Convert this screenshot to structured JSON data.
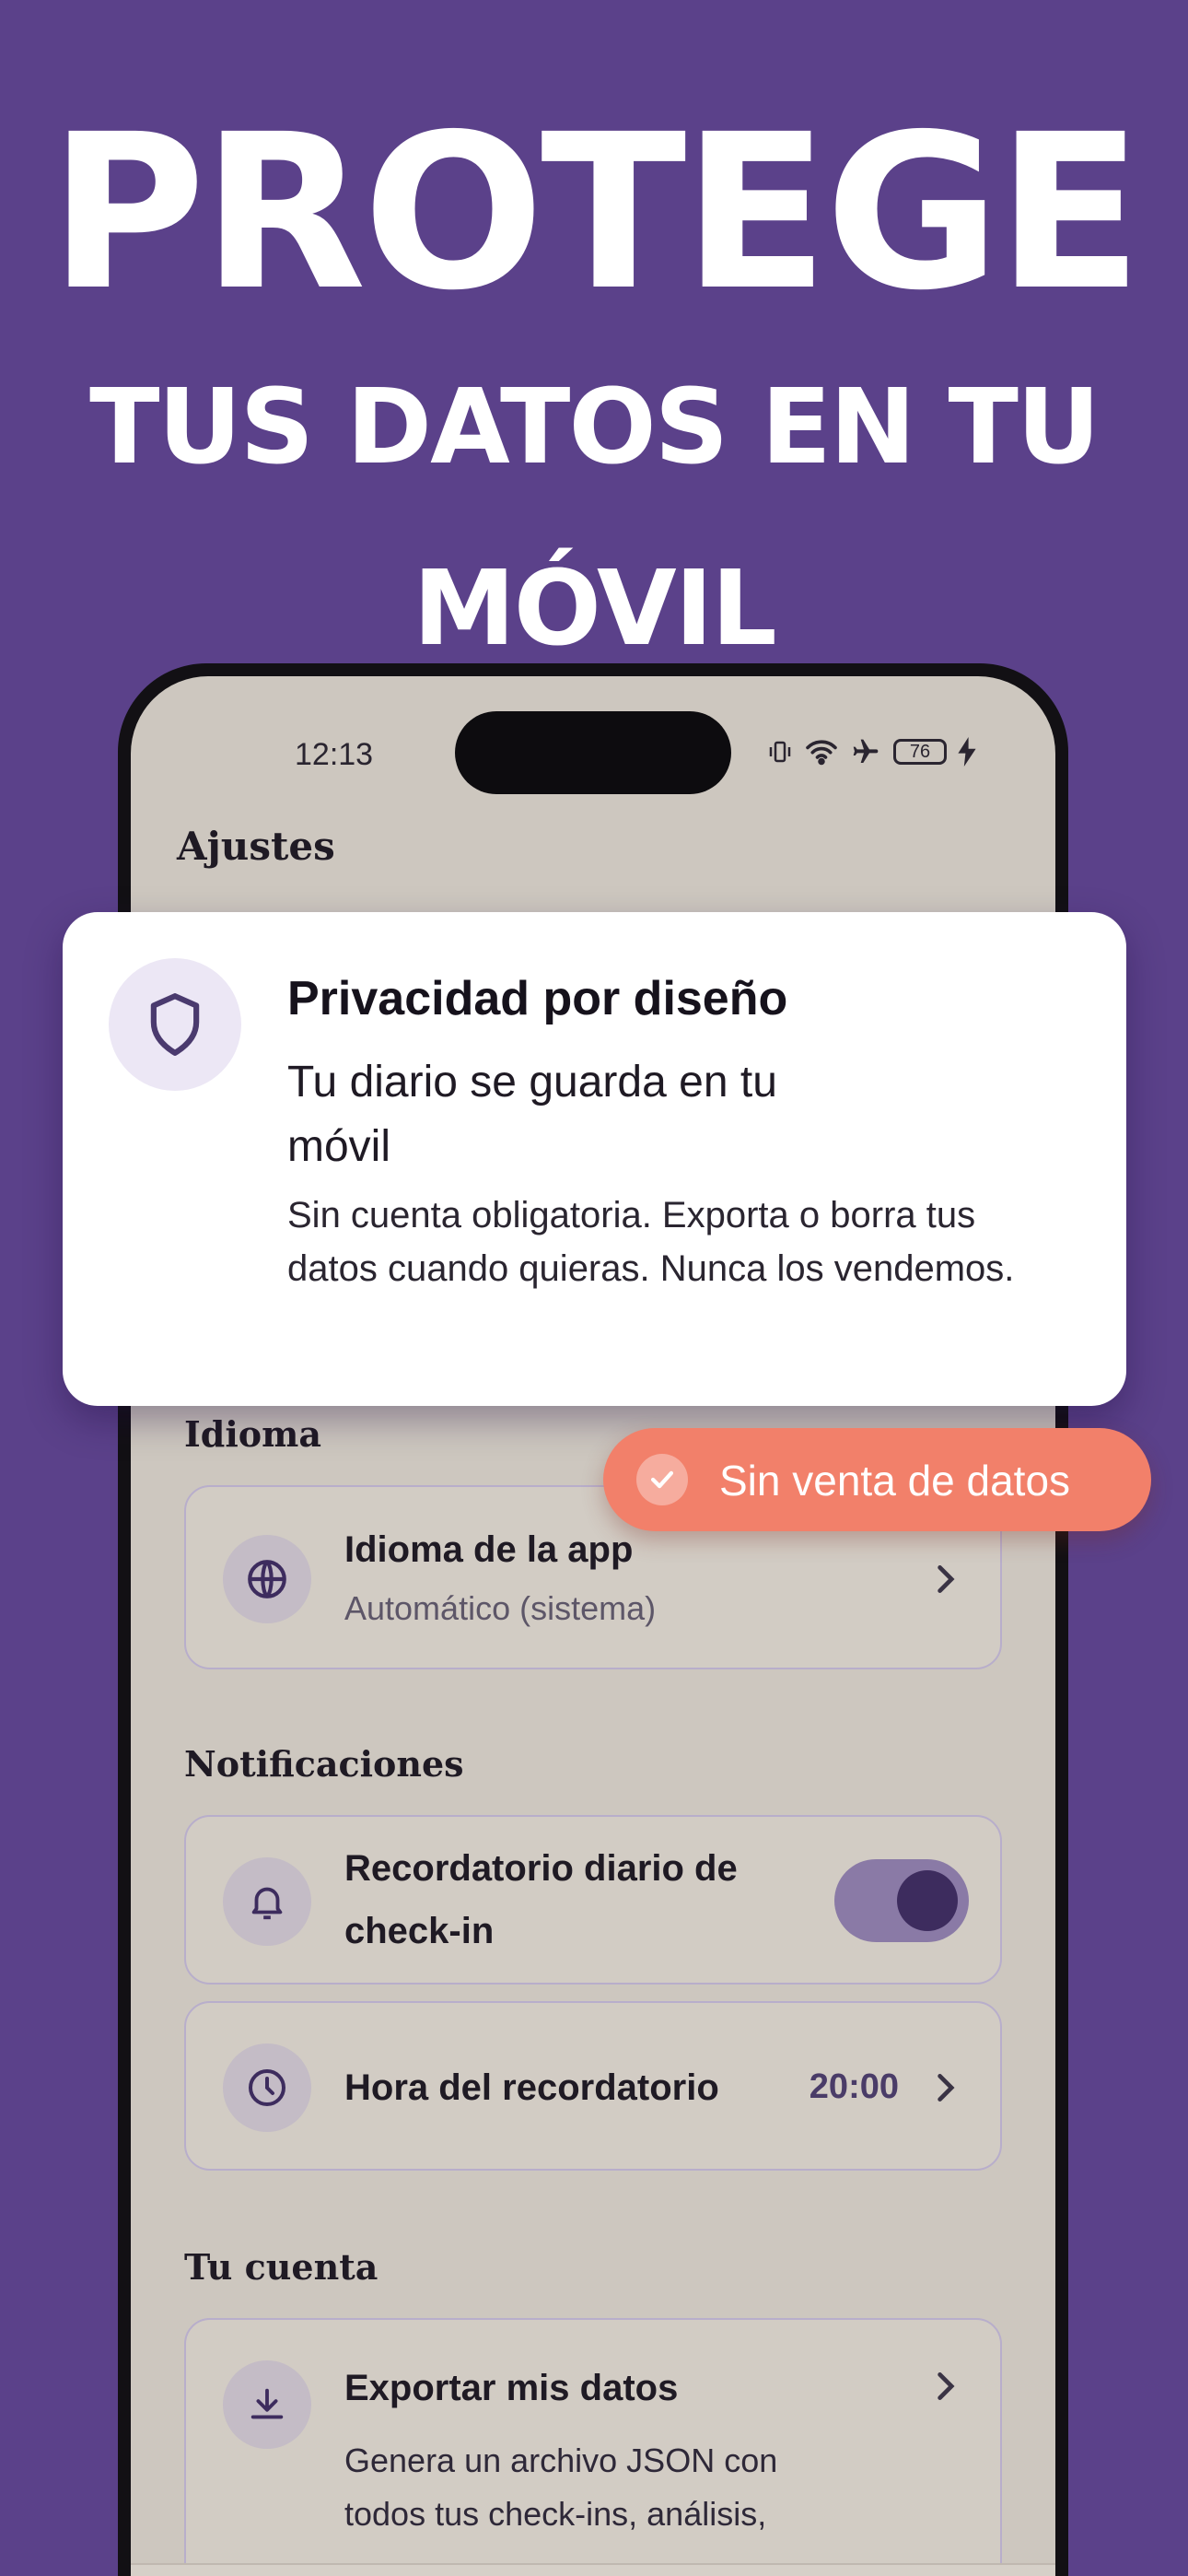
{
  "hero": {
    "line1": "PROTEGE",
    "line2": "TUS DATOS EN TU",
    "line3": "MÓVIL"
  },
  "status_bar": {
    "time": "12:13",
    "battery": "76"
  },
  "screen": {
    "title": "Ajustes"
  },
  "privacy_card": {
    "title": "Privacidad por diseño",
    "subtitle": "Tu diario se guarda en tu móvil",
    "body": "Sin cuenta obligatoria. Exporta o borra tus datos cuando quieras. Nunca los vendemos."
  },
  "badge": {
    "label": "Sin venta de datos"
  },
  "sections": {
    "language": {
      "heading": "Idioma",
      "item_title": "Idioma de la app",
      "item_value": "Automático (sistema)"
    },
    "notifications": {
      "heading": "Notificaciones",
      "reminder_title": "Recordatorio diario de check-in",
      "reminder_enabled": true,
      "time_title": "Hora del recordatorio",
      "time_value": "20:00"
    },
    "account": {
      "heading": "Tu cuenta",
      "export_title": "Exportar mis datos",
      "export_desc": "Genera un archivo JSON con todos tus check-ins, análisis,"
    }
  },
  "colors": {
    "background": "#5b418a",
    "accent": "#f2806a",
    "toggle": "#8a7aa6"
  },
  "icons": {
    "language": "globe-icon",
    "reminder": "bell-icon",
    "time": "clock-icon",
    "export": "download-icon",
    "privacy": "shield-icon",
    "badge": "check-circle-icon"
  }
}
